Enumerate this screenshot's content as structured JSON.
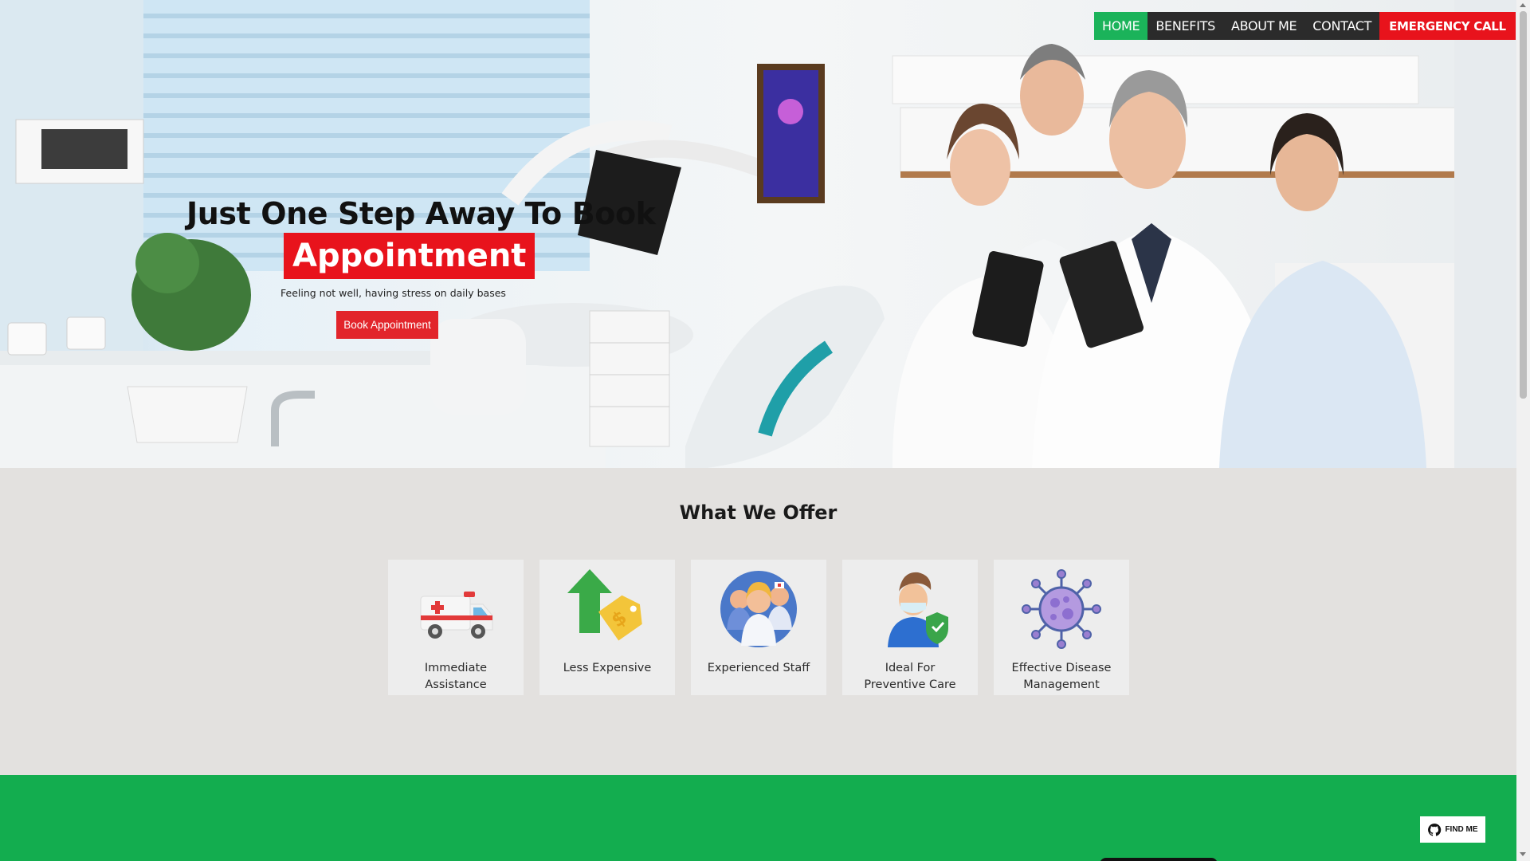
{
  "nav": {
    "items": [
      {
        "label": "HOME",
        "active": true
      },
      {
        "label": "BENEFITS",
        "active": false
      },
      {
        "label": "ABOUT ME",
        "active": false
      },
      {
        "label": "CONTACT",
        "active": false
      }
    ],
    "emergency_label": "EMERGENCY CALL"
  },
  "hero": {
    "title": "Just One Step Away To Book",
    "highlight": "Appointment",
    "subtitle": "Feeling not well, having stress on daily bases",
    "button_label": "Book Appointment"
  },
  "offer": {
    "title": "What We Offer",
    "cards": [
      {
        "label": "Immediate Assistance",
        "icon": "ambulance-icon"
      },
      {
        "label": "Less Expensive",
        "icon": "price-tag-icon"
      },
      {
        "label": "Experienced Staff",
        "icon": "medical-staff-icon"
      },
      {
        "label": "Ideal For Preventive Care",
        "icon": "masked-person-shield-icon"
      },
      {
        "label": "Effective Disease Management",
        "icon": "virus-icon"
      }
    ]
  },
  "footer": {
    "findme_label": "FIND ME"
  },
  "colors": {
    "accent_red": "#e8131c",
    "accent_green": "#13ad4f",
    "nav_dark": "#2b2b2b",
    "offer_bg": "#e3e1df"
  }
}
